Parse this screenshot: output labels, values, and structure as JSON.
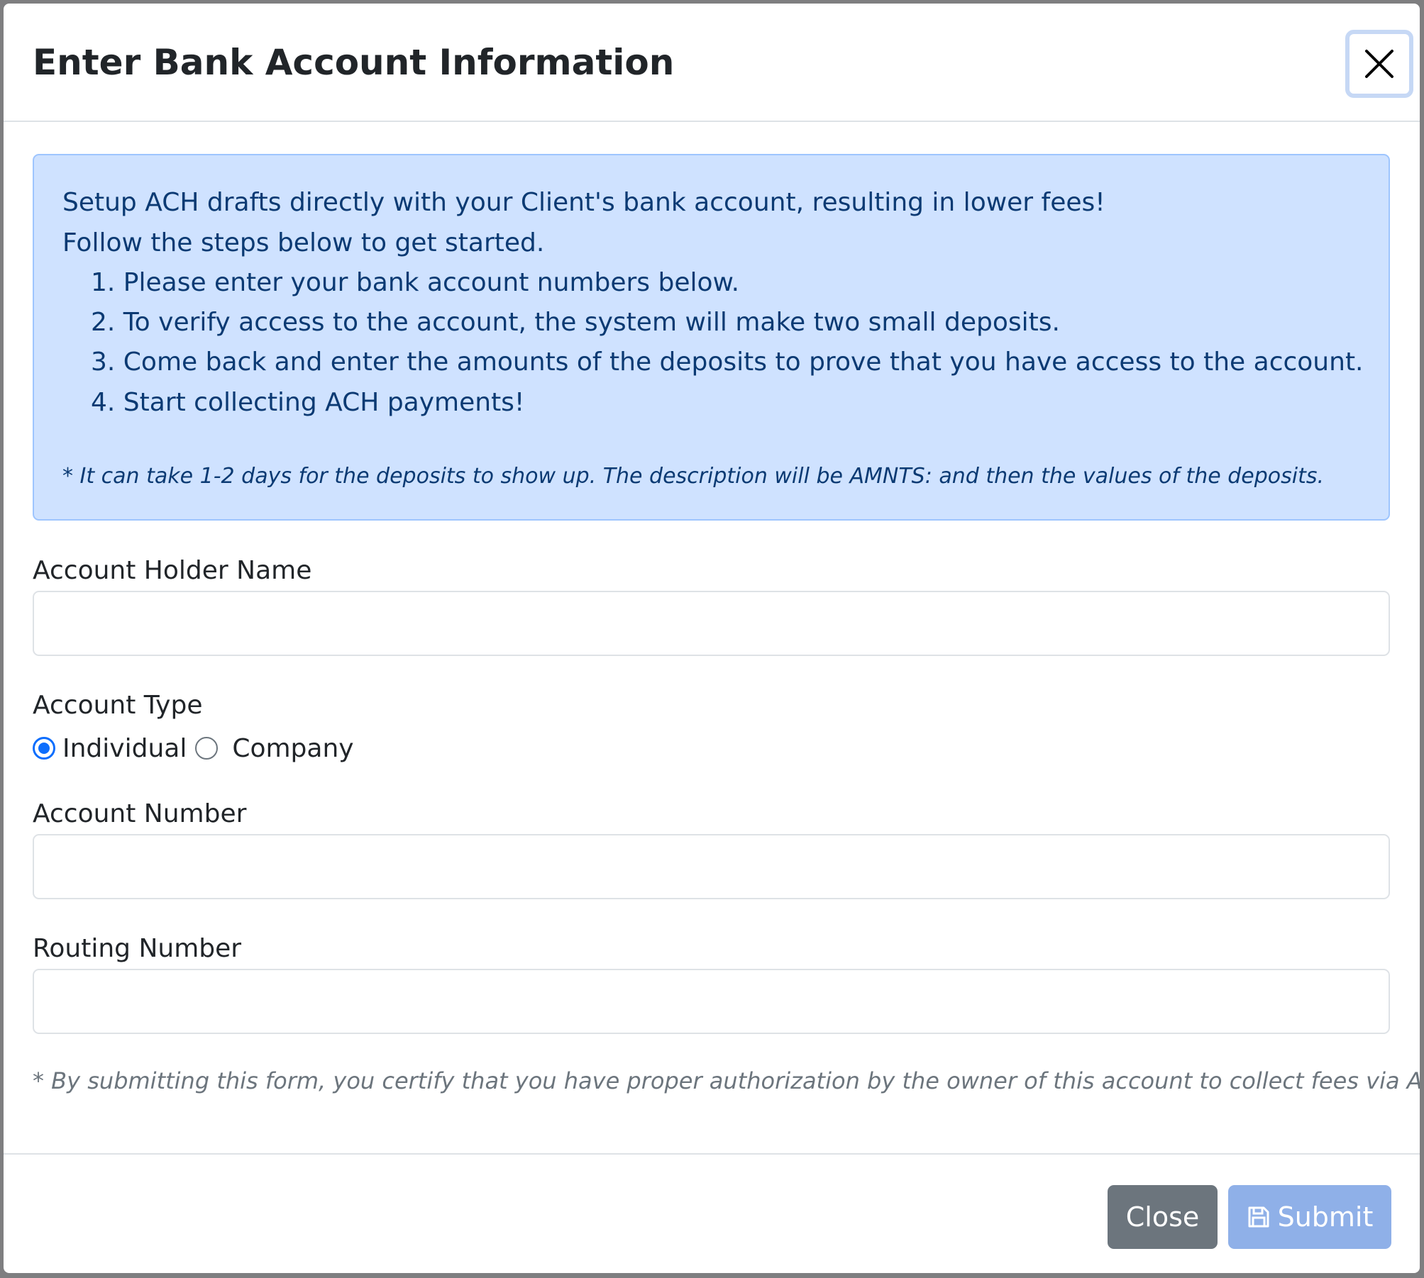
{
  "modal": {
    "title": "Enter Bank Account Information",
    "close_icon": "close-icon"
  },
  "info": {
    "line1": "Setup ACH drafts directly with your Client's bank account, resulting in lower fees!",
    "line2": "Follow the steps below to get started.",
    "steps": [
      "1. Please enter your bank account numbers below.",
      "2. To verify access to the account, the system will make two small deposits.",
      "3. Come back and enter the amounts of the deposits to prove that you have access to the account.",
      "4. Start collecting ACH payments!"
    ],
    "note": "* It can take 1-2 days for the deposits to show up. The description will be AMNTS: and then the values of the deposits."
  },
  "form": {
    "holder_name_label": "Account Holder Name",
    "holder_name_value": "",
    "account_type_label": "Account Type",
    "account_type_options": [
      "Individual",
      "Company"
    ],
    "account_type_selected": "Individual",
    "account_number_label": "Account Number",
    "account_number_value": "",
    "routing_number_label": "Routing Number",
    "routing_number_value": "",
    "disclaimer": "* By submitting this form, you certify that you have proper authorization by the owner of this account to collect fees via ACH."
  },
  "footer": {
    "close_label": "Close",
    "submit_label": "Submit",
    "submit_icon": "save-icon"
  },
  "colors": {
    "alert_bg": "#cfe2ff",
    "primary": "#0d6efd",
    "secondary": "#6c757d",
    "submit_disabled": "#8fb0e8"
  }
}
